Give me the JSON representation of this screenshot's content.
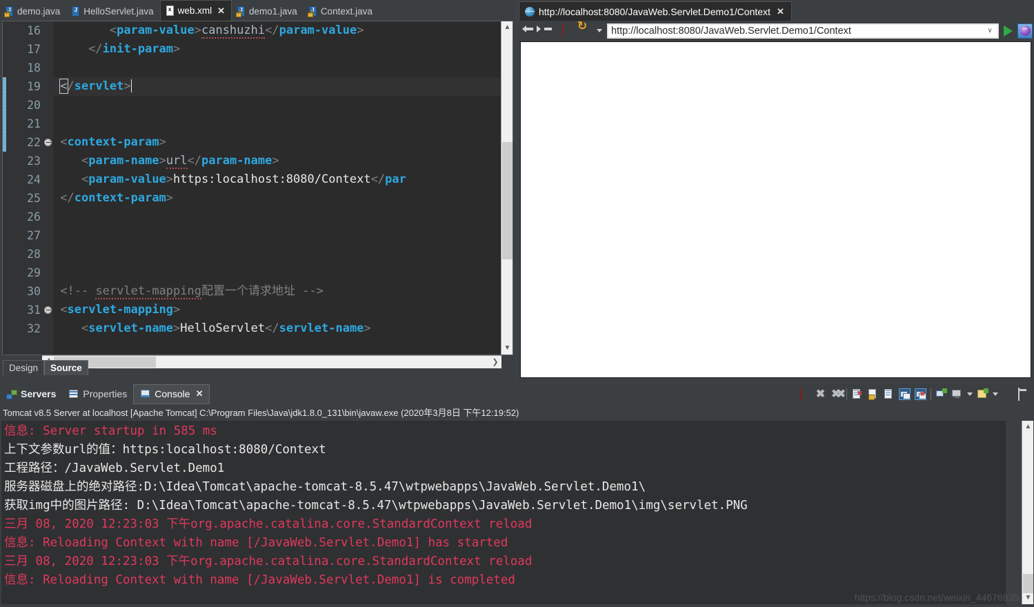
{
  "editor": {
    "tabs": [
      {
        "label": "demo.java",
        "icon": "java-file-locked-icon",
        "glyph": "J",
        "locked": true,
        "active": false,
        "closable": false
      },
      {
        "label": "HelloServlet.java",
        "icon": "java-file-icon",
        "glyph": "J",
        "locked": false,
        "active": false,
        "closable": false
      },
      {
        "label": "web.xml",
        "icon": "xml-file-icon",
        "glyph": "x",
        "locked": false,
        "active": true,
        "closable": true
      },
      {
        "label": "demo1.java",
        "icon": "java-file-locked-icon",
        "glyph": "J",
        "locked": true,
        "active": false,
        "closable": false
      },
      {
        "label": "Context.java",
        "icon": "java-file-locked-icon",
        "glyph": "J",
        "locked": true,
        "active": false,
        "closable": false
      }
    ],
    "close_glyph": "✕",
    "line_numbers": [
      "16",
      "17",
      "18",
      "19",
      "20",
      "21",
      "22",
      "23",
      "24",
      "25",
      "26",
      "27",
      "28",
      "29",
      "30",
      "31",
      "32"
    ],
    "lines": [
      {
        "n": "16",
        "indent": 8,
        "parts": [
          {
            "t": "<",
            "c": "br"
          },
          {
            "t": "param-value",
            "c": "tg"
          },
          {
            "t": ">",
            "c": "br"
          },
          {
            "t": "canshuzhi",
            "c": "squig"
          },
          {
            "t": "<",
            "c": "br"
          },
          {
            "t": "/",
            "c": "br"
          },
          {
            "t": "param-value",
            "c": "tg"
          },
          {
            "t": ">",
            "c": "br"
          }
        ]
      },
      {
        "n": "17",
        "indent": 5,
        "parts": [
          {
            "t": "</",
            "c": "br"
          },
          {
            "t": "init-param",
            "c": "tg"
          },
          {
            "t": ">",
            "c": "br"
          }
        ]
      },
      {
        "n": "18",
        "indent": 0,
        "parts": []
      },
      {
        "n": "19",
        "indent": 1,
        "current": true,
        "parts": [
          {
            "t": "<",
            "c": "cbox"
          },
          {
            "t": "/",
            "c": "br"
          },
          {
            "t": "servlet",
            "c": "tg"
          },
          {
            "t": ">",
            "c": "br"
          },
          {
            "t": "CARET",
            "c": "caret"
          }
        ]
      },
      {
        "n": "20",
        "indent": 0,
        "parts": []
      },
      {
        "n": "21",
        "indent": 0,
        "parts": []
      },
      {
        "n": "22",
        "indent": 1,
        "fold": true,
        "parts": [
          {
            "t": "<",
            "c": "br"
          },
          {
            "t": "context-param",
            "c": "tg"
          },
          {
            "t": ">",
            "c": "br"
          }
        ]
      },
      {
        "n": "23",
        "indent": 4,
        "parts": [
          {
            "t": "<",
            "c": "br"
          },
          {
            "t": "param-name",
            "c": "tg"
          },
          {
            "t": ">",
            "c": "br"
          },
          {
            "t": "url",
            "c": "squig"
          },
          {
            "t": "</",
            "c": "br"
          },
          {
            "t": "param-name",
            "c": "tg"
          },
          {
            "t": ">",
            "c": "br"
          }
        ]
      },
      {
        "n": "24",
        "indent": 4,
        "parts": [
          {
            "t": "<",
            "c": "br"
          },
          {
            "t": "param-value",
            "c": "tg"
          },
          {
            "t": ">",
            "c": "br"
          },
          {
            "t": "https:localhost:8080/Context",
            "c": "tx"
          },
          {
            "t": "</",
            "c": "br"
          },
          {
            "t": "par",
            "c": "tg"
          }
        ]
      },
      {
        "n": "25",
        "indent": 1,
        "parts": [
          {
            "t": "</",
            "c": "br"
          },
          {
            "t": "context-param",
            "c": "tg"
          },
          {
            "t": ">",
            "c": "br"
          }
        ]
      },
      {
        "n": "26",
        "indent": 0,
        "parts": []
      },
      {
        "n": "27",
        "indent": 0,
        "parts": []
      },
      {
        "n": "28",
        "indent": 0,
        "parts": []
      },
      {
        "n": "29",
        "indent": 0,
        "parts": []
      },
      {
        "n": "30",
        "indent": 1,
        "parts": [
          {
            "t": "<!-- ",
            "c": "cm"
          },
          {
            "t": "servlet-mapping",
            "c": "cm squig"
          },
          {
            "t": "配置一个请求地址 -->",
            "c": "cm"
          }
        ]
      },
      {
        "n": "31",
        "indent": 1,
        "fold": true,
        "parts": [
          {
            "t": "<",
            "c": "br"
          },
          {
            "t": "servlet-mapping",
            "c": "tg"
          },
          {
            "t": ">",
            "c": "br"
          }
        ]
      },
      {
        "n": "32",
        "indent": 4,
        "parts": [
          {
            "t": "<",
            "c": "br"
          },
          {
            "t": "servlet-name",
            "c": "tg"
          },
          {
            "t": ">",
            "c": "br"
          },
          {
            "t": "HelloServlet",
            "c": "tx"
          },
          {
            "t": "</",
            "c": "br"
          },
          {
            "t": "servlet-name",
            "c": "tg"
          },
          {
            "t": ">",
            "c": "br"
          }
        ]
      }
    ],
    "bottom_tabs": [
      {
        "label": "Design",
        "selected": false
      },
      {
        "label": "Source",
        "selected": true
      }
    ]
  },
  "browser": {
    "tab_title": "http://localhost:8080/JavaWeb.Servlet.Demo1/Context",
    "tab_close_glyph": "✕",
    "toolbar": {
      "back_icon": "back-arrow-icon",
      "forward_icon": "forward-arrow-icon",
      "stop_icon": "stop-icon",
      "refresh_icon": "refresh-icon",
      "dropdown_icon": "chevron-down-icon",
      "go_icon": "go-play-icon",
      "external_icon": "open-external-browser-icon"
    },
    "url_value": "http://localhost:8080/JavaWeb.Servlet.Demo1/Context",
    "url_chevron": "∨",
    "page_content": ""
  },
  "bottom": {
    "tabs": [
      {
        "label": "Servers",
        "icon": "servers-icon",
        "active": false,
        "bold": true,
        "closable": false
      },
      {
        "label": "Properties",
        "icon": "properties-icon",
        "active": false,
        "bold": false,
        "closable": false
      },
      {
        "label": "Console",
        "icon": "console-icon",
        "active": true,
        "bold": false,
        "closable": true
      }
    ],
    "tab_close_glyph": "✕",
    "toolbar_icons": [
      "terminate-icon",
      "remove-launch-icon",
      "remove-all-terminated-icon",
      "clear-console-icon",
      "scroll-lock-icon",
      "word-wrap-icon",
      "show-console-on-output-icon",
      "show-console-on-error-icon",
      "pin-console-icon",
      "display-selected-console-icon",
      "console-dropdown-icon",
      "open-console-icon",
      "open-console-dropdown-icon",
      "minimize-icon",
      "maximize-icon"
    ],
    "console_header": "Tomcat v8.5 Server at localhost [Apache Tomcat] C:\\Program Files\\Java\\jdk1.8.0_131\\bin\\javaw.exe (2020年3月8日 下午12:19:52)",
    "console_lines": [
      {
        "text": "信息: Server startup in 585 ms",
        "color": "red"
      },
      {
        "text": "上下文参数url的值：https:localhost:8080/Context",
        "color": "white"
      },
      {
        "text": "工程路径：/JavaWeb.Servlet.Demo1",
        "color": "white"
      },
      {
        "text": "服务器磁盘上的绝对路径:D:\\Idea\\Tomcat\\apache-tomcat-8.5.47\\wtpwebapps\\JavaWeb.Servlet.Demo1\\",
        "color": "white"
      },
      {
        "text": "获取img中的图片路径: D:\\Idea\\Tomcat\\apache-tomcat-8.5.47\\wtpwebapps\\JavaWeb.Servlet.Demo1\\img\\servlet.PNG",
        "color": "white"
      },
      {
        "text": "三月 08, 2020 12:23:03 下午org.apache.catalina.core.StandardContext reload",
        "color": "red"
      },
      {
        "text": "信息: Reloading Context with name [/JavaWeb.Servlet.Demo1] has started",
        "color": "red"
      },
      {
        "text": "三月 08, 2020 12:23:03 下午org.apache.catalina.core.StandardContext reload",
        "color": "red"
      },
      {
        "text": "信息: Reloading Context with name [/JavaWeb.Servlet.Demo1] is completed",
        "color": "red"
      }
    ],
    "watermark": "https://blog.csdn.net/weixin_44676935"
  },
  "colors": {
    "background": "#3c3f41",
    "editor_bg": "#2b2b2b",
    "gutter_bg": "#313335",
    "tag": "#2ea8e0",
    "bracket": "#808080",
    "text": "#e8e8e8",
    "comment": "#808080",
    "console_red": "#e0395c",
    "console_bg": "#2f3032",
    "accent": "#3f7fc4"
  }
}
